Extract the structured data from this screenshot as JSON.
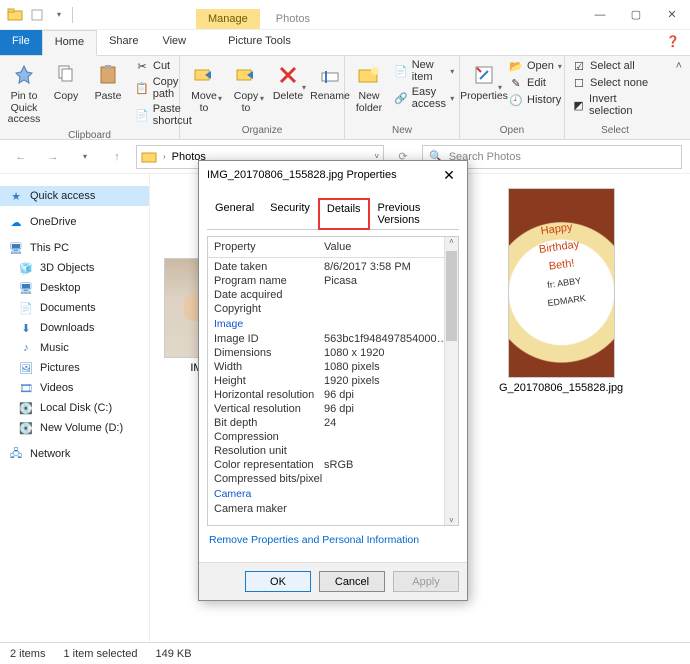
{
  "window": {
    "context_tab": "Manage",
    "context_sub": "Picture Tools",
    "app_title": "Photos",
    "min": "—",
    "max": "▢",
    "close": "✕"
  },
  "menu": {
    "file": "File",
    "home": "Home",
    "share": "Share",
    "view": "View"
  },
  "ribbon": {
    "pin": "Pin to Quick\naccess",
    "copy": "Copy",
    "paste": "Paste",
    "cut": "Cut",
    "copy_path": "Copy path",
    "paste_shortcut": "Paste shortcut",
    "clipboard": "Clipboard",
    "move": "Move\nto",
    "copy_to": "Copy\nto",
    "delete": "Delete",
    "rename": "Rename",
    "organize": "Organize",
    "new_folder": "New\nfolder",
    "new_item": "New item",
    "easy_access": "Easy access",
    "new": "New",
    "properties": "Properties",
    "open": "Open",
    "edit": "Edit",
    "history": "History",
    "open_group": "Open",
    "select_all": "Select all",
    "select_none": "Select none",
    "invert": "Invert selection",
    "select": "Select"
  },
  "address": {
    "location": "Photos",
    "search_placeholder": "Search Photos"
  },
  "sidebar": {
    "quick": "Quick access",
    "onedrive": "OneDrive",
    "thispc": "This PC",
    "items": [
      "3D Objects",
      "Desktop",
      "Documents",
      "Downloads",
      "Music",
      "Pictures",
      "Videos",
      "Local Disk (C:)",
      "New Volume (D:)"
    ],
    "network": "Network"
  },
  "files": {
    "a": "IMG_20170806_155828.jpg",
    "a_short": "IM",
    "b": "G_20170806_155828.jpg",
    "cake_line1": "Happy",
    "cake_line2": "Birthday",
    "cake_line3": "Beth!",
    "cake_line4": "fr: ABBY\nEDMARK"
  },
  "dialog": {
    "title": "IMG_20170806_155828.jpg Properties",
    "tabs": {
      "general": "General",
      "security": "Security",
      "details": "Details",
      "prev": "Previous Versions"
    },
    "col_prop": "Property",
    "col_val": "Value",
    "rows": [
      {
        "k": "Date taken",
        "v": "8/6/2017 3:58 PM"
      },
      {
        "k": "Program name",
        "v": "Picasa"
      },
      {
        "k": "Date acquired",
        "v": ""
      },
      {
        "k": "Copyright",
        "v": ""
      }
    ],
    "section_image": "Image",
    "rows2": [
      {
        "k": "Image ID",
        "v": "563bc1f948497854000000..."
      },
      {
        "k": "Dimensions",
        "v": "1080 x 1920"
      },
      {
        "k": "Width",
        "v": "1080 pixels"
      },
      {
        "k": "Height",
        "v": "1920 pixels"
      },
      {
        "k": "Horizontal resolution",
        "v": "96 dpi"
      },
      {
        "k": "Vertical resolution",
        "v": "96 dpi"
      },
      {
        "k": "Bit depth",
        "v": "24"
      },
      {
        "k": "Compression",
        "v": ""
      },
      {
        "k": "Resolution unit",
        "v": ""
      },
      {
        "k": "Color representation",
        "v": "sRGB"
      },
      {
        "k": "Compressed bits/pixel",
        "v": ""
      }
    ],
    "section_camera": "Camera",
    "rows3": [
      {
        "k": "Camera maker",
        "v": ""
      }
    ],
    "remove_link": "Remove Properties and Personal Information",
    "ok": "OK",
    "cancel": "Cancel",
    "apply": "Apply"
  },
  "status": {
    "items": "2 items",
    "selected": "1 item selected",
    "size": "149 KB"
  },
  "chevron": "▾",
  "chevron_r": "›"
}
